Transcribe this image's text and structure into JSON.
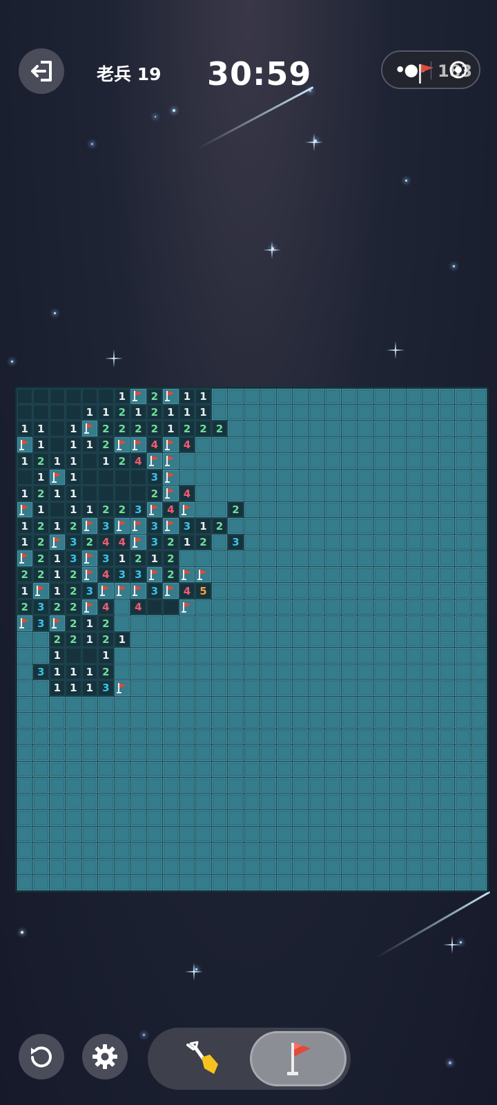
{
  "header": {
    "level_title": "老兵 19",
    "timer": "30:59",
    "flag_count": "183",
    "menu_dots": "•●•"
  },
  "icons": {
    "exit": "exit-icon",
    "flag": "flag-icon",
    "target": "target-icon",
    "undo": "undo-icon",
    "settings": "gear-icon",
    "dig": "shovel-icon"
  },
  "colors": {
    "hidden_cell": "#357c8c",
    "open_cell": "#16333d",
    "num1": "#e8f1f2",
    "num2": "#6fe09a",
    "num3": "#38c2e8",
    "num4": "#f35b72",
    "num5": "#f4a23a",
    "flag": "#e04a3a"
  },
  "board": {
    "cols": 29,
    "rows": 31,
    "legend": "H=hidden, .=open empty, F=flag, 1-5=number",
    "cells": [
      "......1F2F11HHHHHHHHHHHHHHHHH",
      "....11212111HHHHHHHHHHHHHHHHH",
      "11.1F22221222HHHHHHHHHHHHHHHH",
      "F1.112FF4F4HHHHHHHHHHHHHHHHHH",
      "1211.124FFHHHHHHHHHHHHHHHHHHH",
      ".1F1....3FHHHHHHHHHHHHHHHHHHH",
      "1211....2F4HHHHHHHHHHHHHHHHHH",
      "F1.11223F4FHH2HHHHHHHHHHHHHHH",
      "1212F3FF3F312HHHHHHHHHHHHHHHH",
      "12F3244F3212H3HHHHHHHHHHHHHHH",
      "F213F31212HHHHHHHHHHHHHHHHHHH",
      "2212F433F2FFHHHHHHHHHHHHHHHHH",
      "1F123FFF3F45HHHHHHHHHHHHHHHHH",
      "2322F4H4..FHHHHHHHHHHHHHHHHHH",
      "F3F212HHHHHHHHHHHHHHHHHHHHHHH",
      "HH22121HHHHHHHHHHHHHHHHHHHHHH",
      "HH1..1HHHHHHHHHHHHHHHHHHHHHHH",
      "H31112HHHHHHHHHHHHHHHHHHHHHHH",
      "HH1113FHHHHHHHHHHHHHHHHHHHHHH",
      "HHHHHHHHHHHHHHHHHHHHHHHHHHHHH",
      "HHHHHHHHHHHHHHHHHHHHHHHHHHHHH",
      "HHHHHHHHHHHHHHHHHHHHHHHHHHHHH",
      "HHHHHHHHHHHHHHHHHHHHHHHHHHHHH",
      "HHHHHHHHHHHHHHHHHHHHHHHHHHHHH",
      "HHHHHHHHHHHHHHHHHHHHHHHHHHHHH",
      "HHHHHHHHHHHHHHHHHHHHHHHHHHHHH",
      "HHHHHHHHHHHHHHHHHHHHHHHHHHHHH",
      "HHHHHHHHHHHHHHHHHHHHHHHHHHHHH",
      "HHHHHHHHHHHHHHHHHHHHHHHHHHHHH",
      "HHHHHHHHHHHHHHHHHHHHHHHHHHHHH",
      "HHHHHHHHHHHHHHHHHHHHHHHHHHHHH"
    ]
  },
  "controls": {
    "active_mode": "flag"
  }
}
